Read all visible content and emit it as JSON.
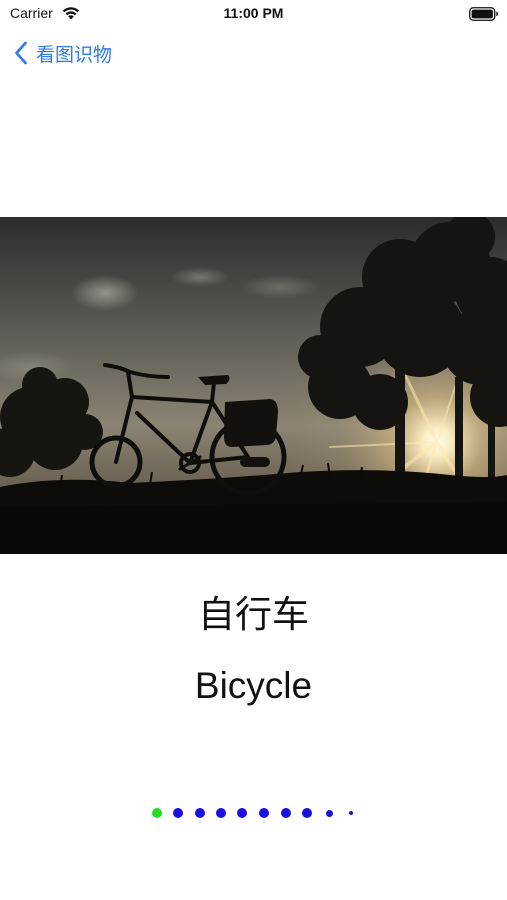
{
  "status_bar": {
    "carrier": "Carrier",
    "time": "11:00 PM"
  },
  "nav": {
    "back_label": "看图识物",
    "accent_color": "#2f7bf0"
  },
  "card": {
    "image_subject": "bicycle silhouette at sunset",
    "chinese_word": "自行车",
    "english_word": "Bicycle"
  },
  "pager": {
    "page_count": 10,
    "current_index": 0,
    "active_color": "#22dd22",
    "inactive_color": "#1a10e0"
  }
}
